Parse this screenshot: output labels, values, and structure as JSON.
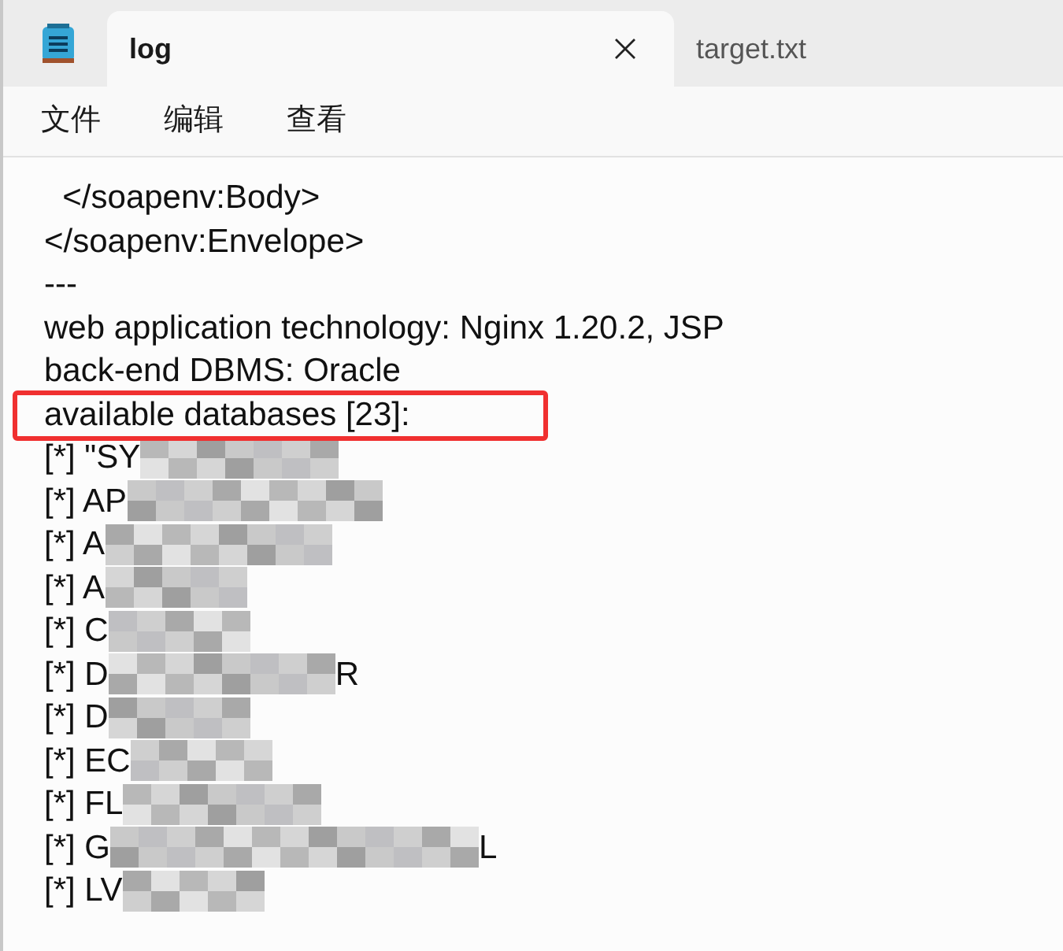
{
  "tabs": [
    {
      "label": "log",
      "selected": true
    },
    {
      "label": "target.txt",
      "selected": false
    }
  ],
  "menu": [
    "文件",
    "编辑",
    "查看"
  ],
  "lines": [
    {
      "kind": "text",
      "text": "  </soapenv:Body>"
    },
    {
      "kind": "text",
      "text": "</soapenv:Envelope>"
    },
    {
      "kind": "text",
      "text": "---"
    },
    {
      "kind": "text",
      "text": "web application technology: Nginx 1.20.2, JSP"
    },
    {
      "kind": "text",
      "text": "back-end DBMS: Oracle"
    },
    {
      "kind": "text",
      "text": "available databases [23]:",
      "highlighted": true
    },
    {
      "kind": "redacted",
      "text": "[*] \"SY"
    },
    {
      "kind": "redacted",
      "text": "[*] AP"
    },
    {
      "kind": "redacted",
      "text": "[*] A"
    },
    {
      "kind": "redacted",
      "text": "[*] A"
    },
    {
      "kind": "redacted",
      "text": "[*] C"
    },
    {
      "kind": "redacted",
      "text": "[*] D",
      "tail": "R"
    },
    {
      "kind": "redacted",
      "text": "[*] D"
    },
    {
      "kind": "redacted",
      "text": "[*] EC"
    },
    {
      "kind": "redacted",
      "text": "[*] FL"
    },
    {
      "kind": "redacted",
      "text": "[*] G",
      "tail": "L"
    },
    {
      "kind": "redacted",
      "text": "[*] LV"
    }
  ]
}
